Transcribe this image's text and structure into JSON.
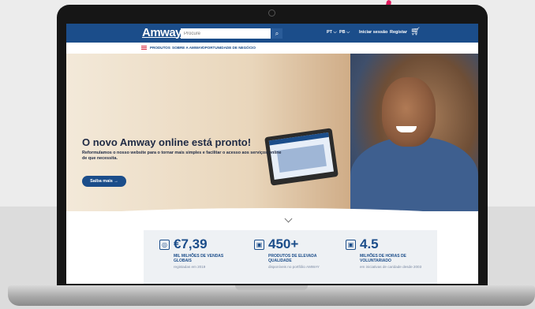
{
  "header": {
    "logo": "Amway",
    "search_placeholder": "Procure",
    "search_icon": "search-icon",
    "country": "PT",
    "language": "PB",
    "login_label": "Iniciar sessão",
    "register_label": "Registar",
    "cart_icon": "cart-icon"
  },
  "nav": {
    "items": [
      "PRODUTOS",
      "SOBRE A AMWAY",
      "OPORTUNIDADE DE NEGÓCIO"
    ]
  },
  "hero": {
    "title": "O novo Amway online está pronto!",
    "subtitle": "Reformulamos o nosso website para o tornar mais simples e facilitar o acesso aos serviços online de que necessita.",
    "button_label": "Saiba mais →"
  },
  "stats": [
    {
      "icon": "globe-icon",
      "value": "€7,39",
      "label": "MIL MILHÕES DE VENDAS GLOBAIS",
      "note": "registadas em 2019"
    },
    {
      "icon": "gift-icon",
      "value": "450+",
      "label": "PRODUTOS DE ELEVADA QUALIDADE",
      "note": "disponíveis no portfólio AMWAY"
    },
    {
      "icon": "gift-icon",
      "value": "4.5",
      "label": "MILHÕES DE HORAS DE VOLUNTARIADO",
      "note": "em iniciativas de caridade desde 2003"
    }
  ],
  "colors": {
    "brand_blue": "#1b4d8a",
    "accent_red": "#d6243a",
    "pink_accent": "#e0185c"
  }
}
